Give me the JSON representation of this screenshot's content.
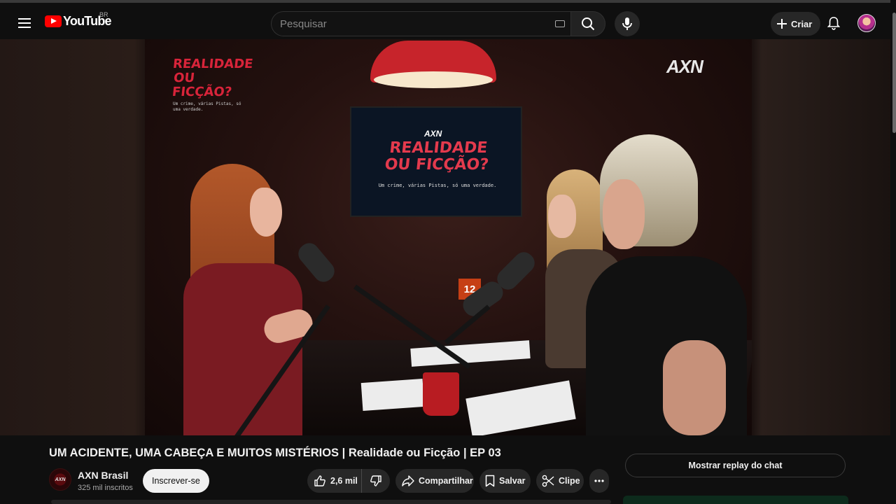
{
  "header": {
    "logo_text": "YouTube",
    "region": "BR",
    "search_placeholder": "Pesquisar",
    "create_label": "Criar"
  },
  "video": {
    "frame": {
      "show_title_top": "REALIDADE",
      "show_title_bottom": "OU FICÇÃO?",
      "show_tagline": "Um crime, várias Pistas, só uma verdade.",
      "network_logo": "AXN",
      "tv_brand": "AXN",
      "clock_number": "12"
    },
    "title": "UM ACIDENTE, UMA CABEÇA E MUITOS MISTÉRIOS | Realidade ou Ficção | EP 03"
  },
  "channel": {
    "avatar_text": "AXN",
    "name": "AXN Brasil",
    "subscribers": "325 mil inscritos",
    "subscribe_label": "Inscrever-se"
  },
  "actions": {
    "likes": "2,6 mil",
    "share_label": "Compartilhar",
    "save_label": "Salvar",
    "clip_label": "Clipe"
  },
  "chat": {
    "replay_label": "Mostrar replay do chat"
  },
  "colors": {
    "brand_red": "#ff0000",
    "background": "#0f0f0f",
    "pill_bg": "#272727",
    "show_red": "#d8243a"
  }
}
